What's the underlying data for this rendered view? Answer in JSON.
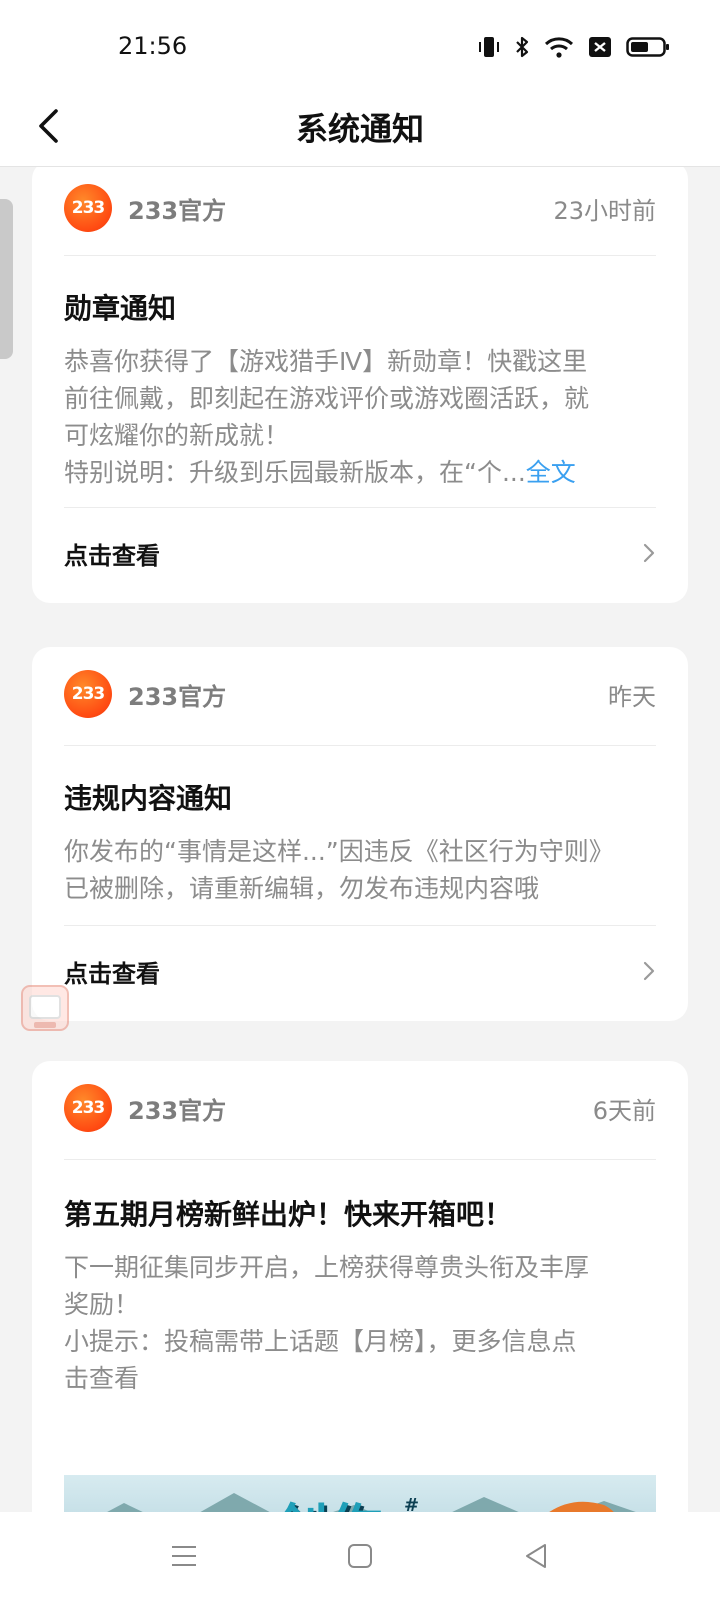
{
  "status_bar": {
    "time": "21:56"
  },
  "header": {
    "title": "系统通知"
  },
  "notifications": [
    {
      "sender": "233官方",
      "avatar_text": "233",
      "time": "23小时前",
      "title": "勋章通知",
      "body_lines": [
        "恭喜你获得了【游戏猎手Ⅳ】新勋章！快戳这里",
        "前往佩戴，即刻起在游戏评价或游戏圈活跃，就",
        "可炫耀你的新成就！"
      ],
      "body_last": "特别说明：升级到乐园最新版本，在“个...",
      "full_text_link": "全文",
      "action": "点击查看"
    },
    {
      "sender": "233官方",
      "avatar_text": "233",
      "time": "昨天",
      "title": "违规内容通知",
      "body_lines": [
        "你发布的“事情是这样...”因违反《社区行为守则》",
        "已被删除，请重新编辑，勿发布违规内容哦"
      ],
      "action": "点击查看"
    },
    {
      "sender": "233官方",
      "avatar_text": "233",
      "time": "6天前",
      "title": "第五期月榜新鲜出炉！快来开箱吧！",
      "body_lines": [
        "下一期征集同步开启，上榜获得尊贵头衔及丰厚",
        "奖励！",
        "小提示：投稿需带上话题【月榜】，更多信息点",
        "击查看"
      ],
      "banner_text": "创作",
      "banner_side_text": "#第"
    }
  ],
  "colors": {
    "accent_orange": "#ff5a1f",
    "link_blue": "#3aa0f0",
    "background": "#f3f3f3"
  },
  "icons": {
    "back": "chevron-left-icon",
    "chevron": "chevron-right-icon",
    "nav_menu": "menu-icon",
    "nav_home": "home-square-icon",
    "nav_back": "back-triangle-icon"
  }
}
